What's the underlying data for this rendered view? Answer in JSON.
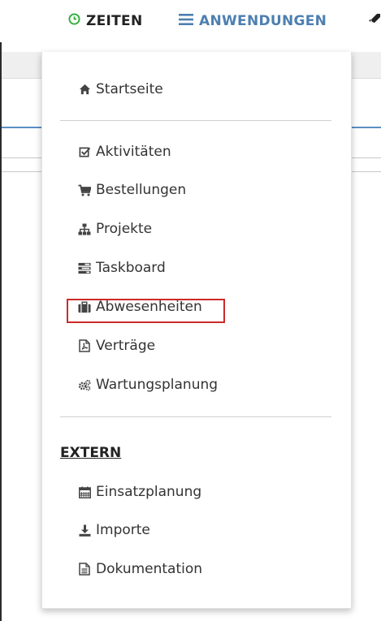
{
  "nav": {
    "zeiten": "ZEITEN",
    "anwendungen": "ANWENDUNGEN"
  },
  "menu": {
    "home": "Startseite",
    "group1": [
      "Aktivitäten",
      "Bestellungen",
      "Projekte",
      "Taskboard",
      "Abwesenheiten",
      "Verträge",
      "Wartungsplanung"
    ],
    "extern_title": "EXTERN",
    "group2": [
      "Einsatzplanung",
      "Importe",
      "Dokumentation"
    ]
  },
  "colors": {
    "accent": "#4d7fb0",
    "clock": "#2fae3a",
    "highlight": "#cc2a2a"
  }
}
